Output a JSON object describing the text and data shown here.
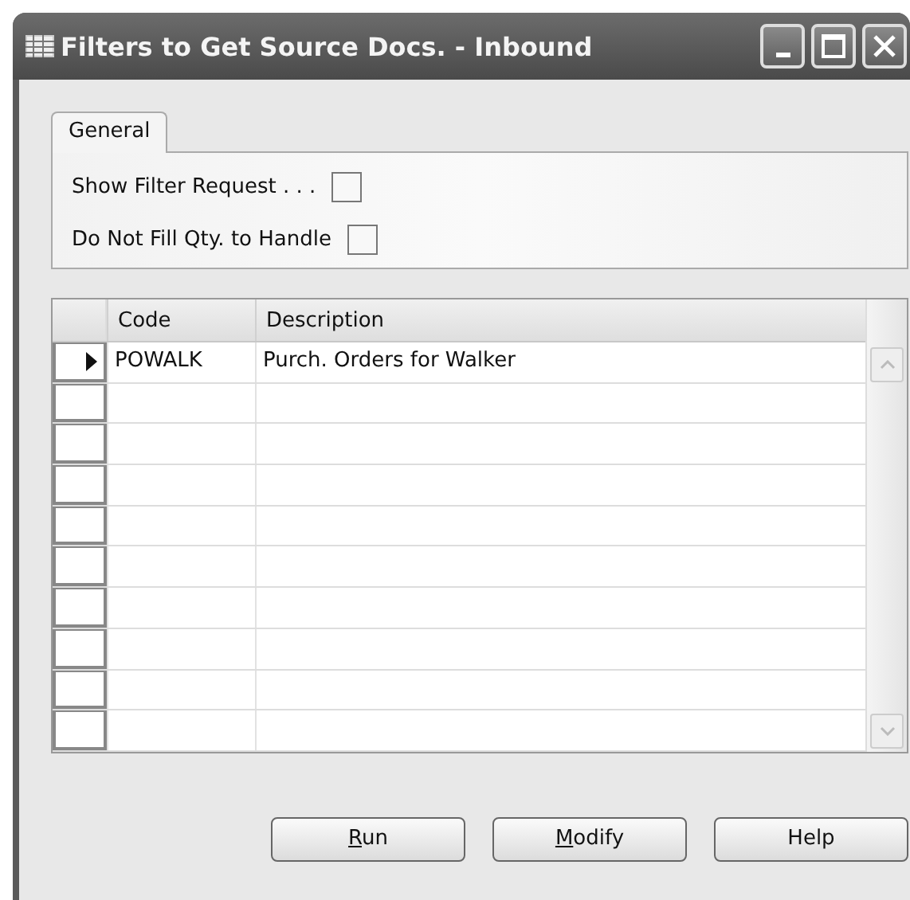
{
  "window": {
    "title": "Filters to Get Source Docs. - Inbound"
  },
  "tabs": [
    {
      "label": "General",
      "selected": true
    }
  ],
  "fields": [
    {
      "label": "Show Filter Request . . .",
      "checked": false
    },
    {
      "label": "Do Not Fill Qty. to Handle",
      "checked": false
    }
  ],
  "table": {
    "columns": [
      "Code",
      "Description"
    ],
    "rows": [
      {
        "selected": true,
        "cells": [
          "POWALK",
          "Purch. Orders for Walker"
        ]
      },
      {
        "selected": false
      },
      {
        "selected": false
      },
      {
        "selected": false
      },
      {
        "selected": false
      },
      {
        "selected": false
      },
      {
        "selected": false
      },
      {
        "selected": false
      },
      {
        "selected": false
      },
      {
        "selected": false
      }
    ]
  },
  "buttons": [
    {
      "label": "Run",
      "underline_first": true
    },
    {
      "label": "Modify",
      "underline_first": true
    },
    {
      "label": "Help",
      "underline_first": false
    }
  ]
}
